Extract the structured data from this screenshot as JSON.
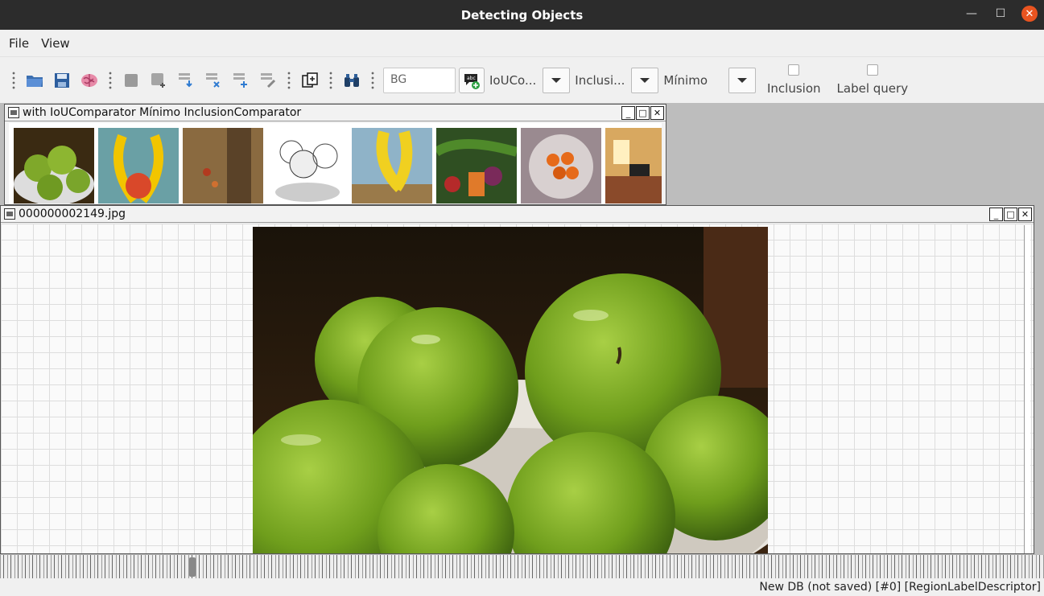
{
  "window": {
    "title": "Detecting Objects"
  },
  "menu": {
    "items": [
      "File",
      "View"
    ]
  },
  "toolbar": {
    "bg_value": "BG",
    "comparator_label": "IoUCo...",
    "inclusion_label": "Inclusi...",
    "minimo_label": "Mínimo",
    "checkbox_inclusion": "Inclusion",
    "checkbox_label_query": "Label query"
  },
  "results_frame": {
    "title": "with IoUComparator Mínimo InclusionComparator"
  },
  "image_frame": {
    "title": "000000002149.jpg"
  },
  "status": {
    "text": "New DB (not saved) [#0] [RegionLabelDescriptor]"
  },
  "colors": {
    "accent_close": "#e95420",
    "titlebar": "#2c2c2c",
    "desktop": "#bdbdbd"
  },
  "icons": [
    "open-folder-icon",
    "save-icon",
    "brain-icon",
    "square-icon",
    "add-region-icon",
    "download-icon",
    "remove-icon",
    "add-icon",
    "search-edit-icon",
    "copy-icon",
    "binoculars-icon",
    "add-label-icon"
  ]
}
